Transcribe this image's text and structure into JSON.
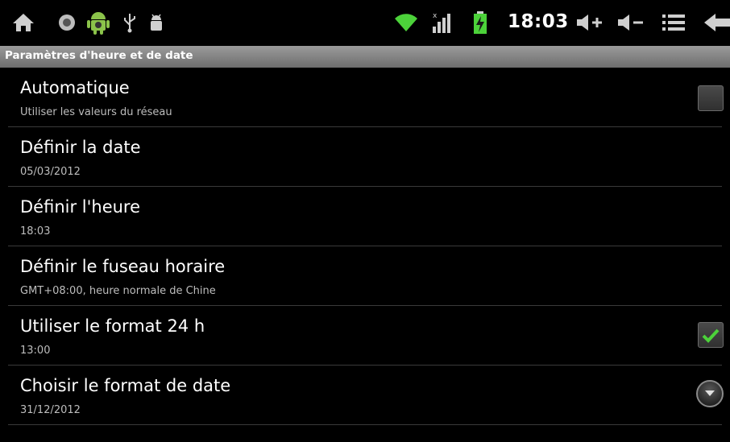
{
  "status_bar": {
    "time": "18:03",
    "icons": [
      "home-icon",
      "record-icon",
      "android-icon",
      "usb-icon",
      "debug-icon",
      "wifi-icon",
      "signal-icon",
      "battery-charging-icon",
      "volume-up-icon",
      "volume-down-icon",
      "menu-icon",
      "back-icon"
    ],
    "accent": "#4cd23a"
  },
  "header": {
    "title": "Paramètres d'heure et de date"
  },
  "settings": [
    {
      "title": "Automatique",
      "summary": "Utiliser les valeurs du réseau",
      "control": "checkbox",
      "checked": false
    },
    {
      "title": "Définir la date",
      "summary": "05/03/2012",
      "control": "none"
    },
    {
      "title": "Définir l'heure",
      "summary": "18:03",
      "control": "none"
    },
    {
      "title": "Définir le fuseau horaire",
      "summary": "GMT+08:00, heure normale de Chine",
      "control": "none"
    },
    {
      "title": "Utiliser le format 24 h",
      "summary": "13:00",
      "control": "checkbox",
      "checked": true
    },
    {
      "title": "Choisir le format de date",
      "summary": "31/12/2012",
      "control": "dropdown"
    }
  ]
}
